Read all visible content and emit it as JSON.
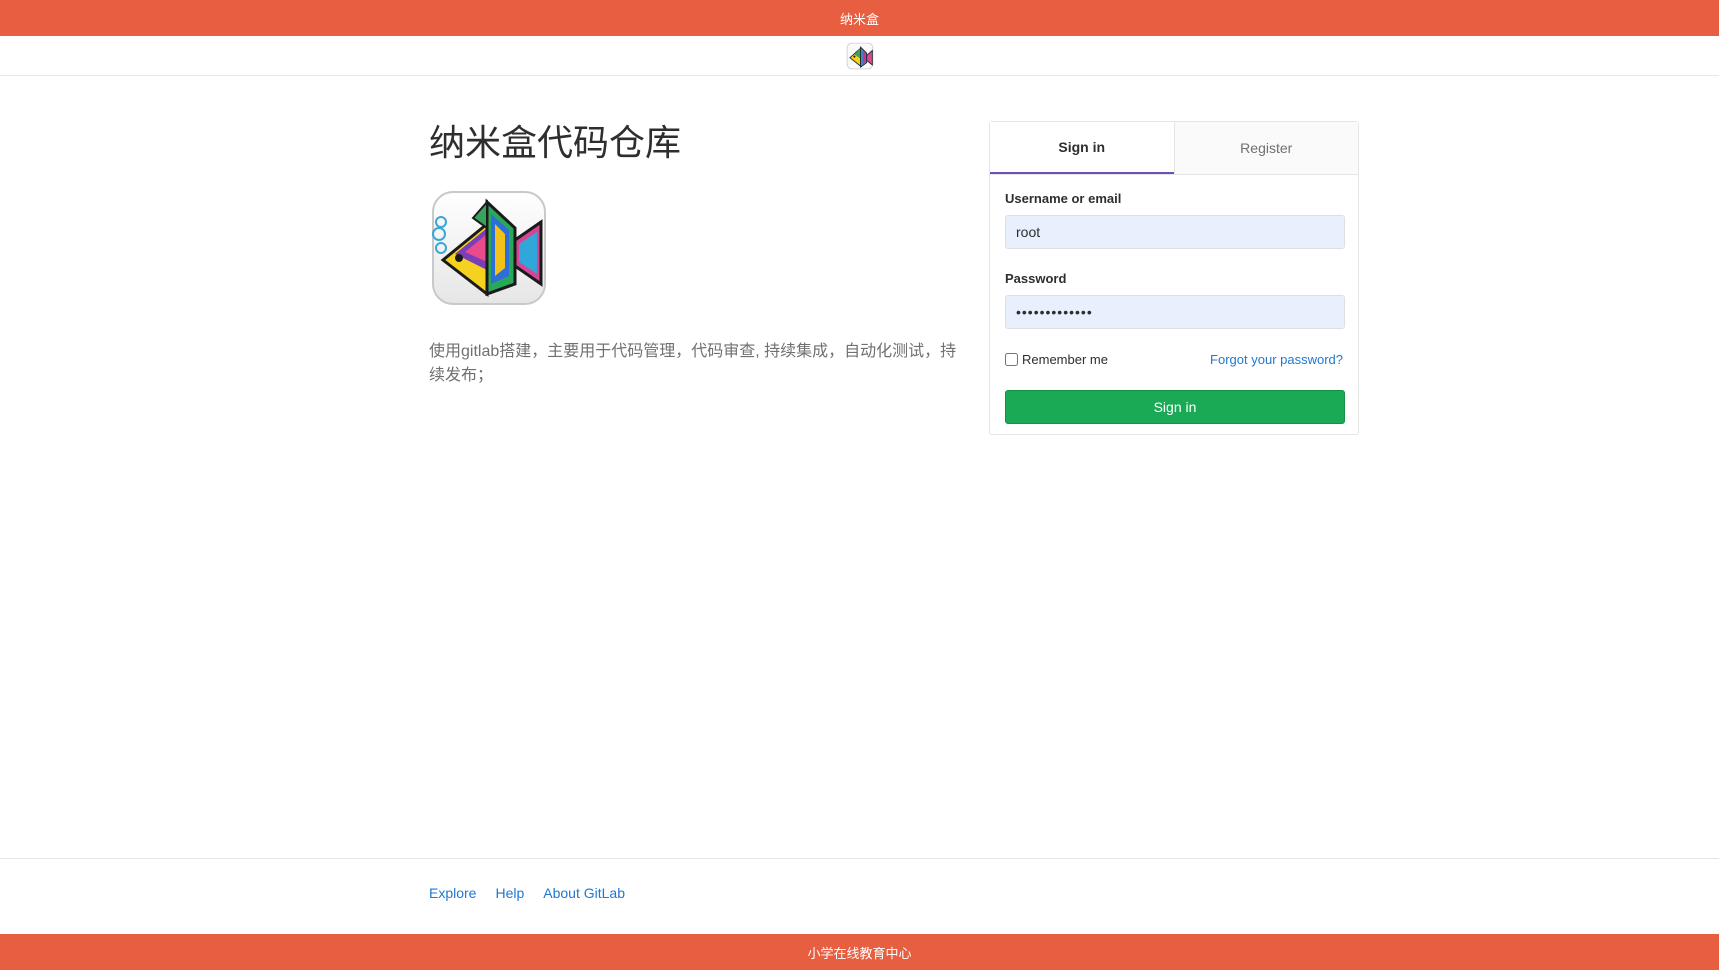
{
  "top_bar": {
    "title": "纳米盒"
  },
  "navbar": {
    "logo_icon": "colorful-fish-logo-icon"
  },
  "brand": {
    "title": "纳米盒代码仓库",
    "logo_icon": "colorful-fish-logo-icon",
    "description": "使用gitlab搭建，主要用于代码管理，代码审查, 持续集成，自动化测试，持续发布；"
  },
  "login": {
    "tabs": [
      {
        "label": "Sign in",
        "active": true
      },
      {
        "label": "Register",
        "active": false
      }
    ],
    "username_label": "Username or email",
    "username_value": "root",
    "password_label": "Password",
    "password_value": "•••••••••••••",
    "remember_label": "Remember me",
    "remember_checked": false,
    "forgot_label": "Forgot your password?",
    "submit_label": "Sign in"
  },
  "footer": {
    "links": [
      "Explore",
      "Help",
      "About GitLab"
    ]
  },
  "bottom_bar": {
    "title": "小学在线教育中心"
  },
  "colors": {
    "bar": "#e75e40",
    "accent_tab": "#6b4fbb",
    "button": "#1aaa55",
    "link": "#1f78d1",
    "autofill": "#e8f0fe"
  }
}
